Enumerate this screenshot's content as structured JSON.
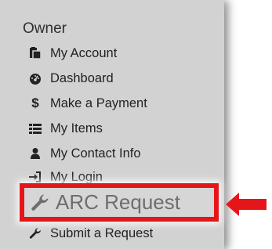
{
  "menu": {
    "section_title": "Owner",
    "items": [
      {
        "label": "My Account",
        "icon": "clipboard-icon"
      },
      {
        "label": "Dashboard",
        "icon": "dashboard-icon"
      },
      {
        "label": "Make a Payment",
        "icon": "dollar-icon"
      },
      {
        "label": "My Items",
        "icon": "list-icon"
      },
      {
        "label": "My Contact Info",
        "icon": "user-icon"
      },
      {
        "label": "My Login",
        "icon": "sign-in-icon"
      },
      {
        "label": "ARC Request",
        "icon": "wrench-icon",
        "highlighted": true
      },
      {
        "label": "Submit a Request",
        "icon": "wrench-icon"
      }
    ]
  },
  "annotation": {
    "highlight_color": "#e5161a",
    "arrow_direction": "left"
  }
}
